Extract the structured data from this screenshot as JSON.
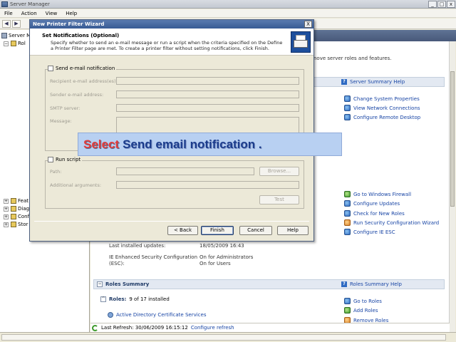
{
  "server_manager": {
    "title": "Server Manager",
    "window_buttons": [
      "_",
      "□",
      "x"
    ],
    "menu": [
      "File",
      "Action",
      "View",
      "Help"
    ],
    "tree": [
      {
        "label": "Server M",
        "expander": "",
        "icon": "server"
      },
      {
        "label": "Rol",
        "expander": "−",
        "icon": "folder"
      },
      {
        "label": "Feat",
        "expander": "+",
        "icon": "folder"
      },
      {
        "label": "Diag",
        "expander": "+",
        "icon": "folder"
      },
      {
        "label": "Conf",
        "expander": "+",
        "icon": "folder"
      },
      {
        "label": "Stor",
        "expander": "+",
        "icon": "folder"
      }
    ],
    "intro_text": "nove server roles and features.",
    "summary_section": {
      "help_link": "Server Summary Help",
      "links": [
        "Change System Properties",
        "View Network Connections",
        "Configure Remote Desktop"
      ]
    },
    "security_section": {
      "links": [
        "Go to Windows Firewall",
        "Configure Updates",
        "Check for New Roles",
        "Run Security Configuration Wizard",
        "Configure IE ESC"
      ],
      "details": [
        {
          "label": "Last installed updates:",
          "value": "18/05/2009 16:43"
        },
        {
          "label": "IE Enhanced Security Configuration",
          "value": "On for Administrators"
        },
        {
          "label": "(ESC):",
          "value": "On for Users"
        }
      ]
    },
    "roles_summary": {
      "title": "Roles Summary",
      "help_link": "Roles Summary Help",
      "roles_label": "Roles:",
      "roles_count": "9 of 17 installed",
      "first_role": "Active Directory Certificate Services",
      "links": [
        "Go to Roles",
        "Add Roles",
        "Remove Roles"
      ]
    },
    "status": {
      "last_refresh": "Last Refresh: 30/06/2009 16:15:12",
      "configure_refresh": "Configure refresh"
    }
  },
  "wizard": {
    "title": "New Printer Filter Wizard",
    "close_label": "X",
    "header_title": "Set Notifications (Optional)",
    "header_desc": "Specify whether to send an e-mail message or run a script when the criteria specified on the Define a Printer Filter page are met. To create a printer filter without setting notifications, click Finish.",
    "email": {
      "checkbox_label": "Send e-mail notification",
      "recipient_label": "Recipient e-mail address(es):",
      "sender_label": "Sender e-mail address:",
      "smtp_label": "SMTP server:",
      "message_label": "Message:"
    },
    "script": {
      "checkbox_label": "Run script",
      "path_label": "Path:",
      "browse_label": "Browse...",
      "args_label": "Additional arguments:",
      "test_label": "Test"
    },
    "buttons": {
      "back": "< Back",
      "finish": "Finish",
      "cancel": "Cancel",
      "help": "Help"
    }
  },
  "callout": {
    "verb": "Select",
    "target": "Send email notification ."
  }
}
